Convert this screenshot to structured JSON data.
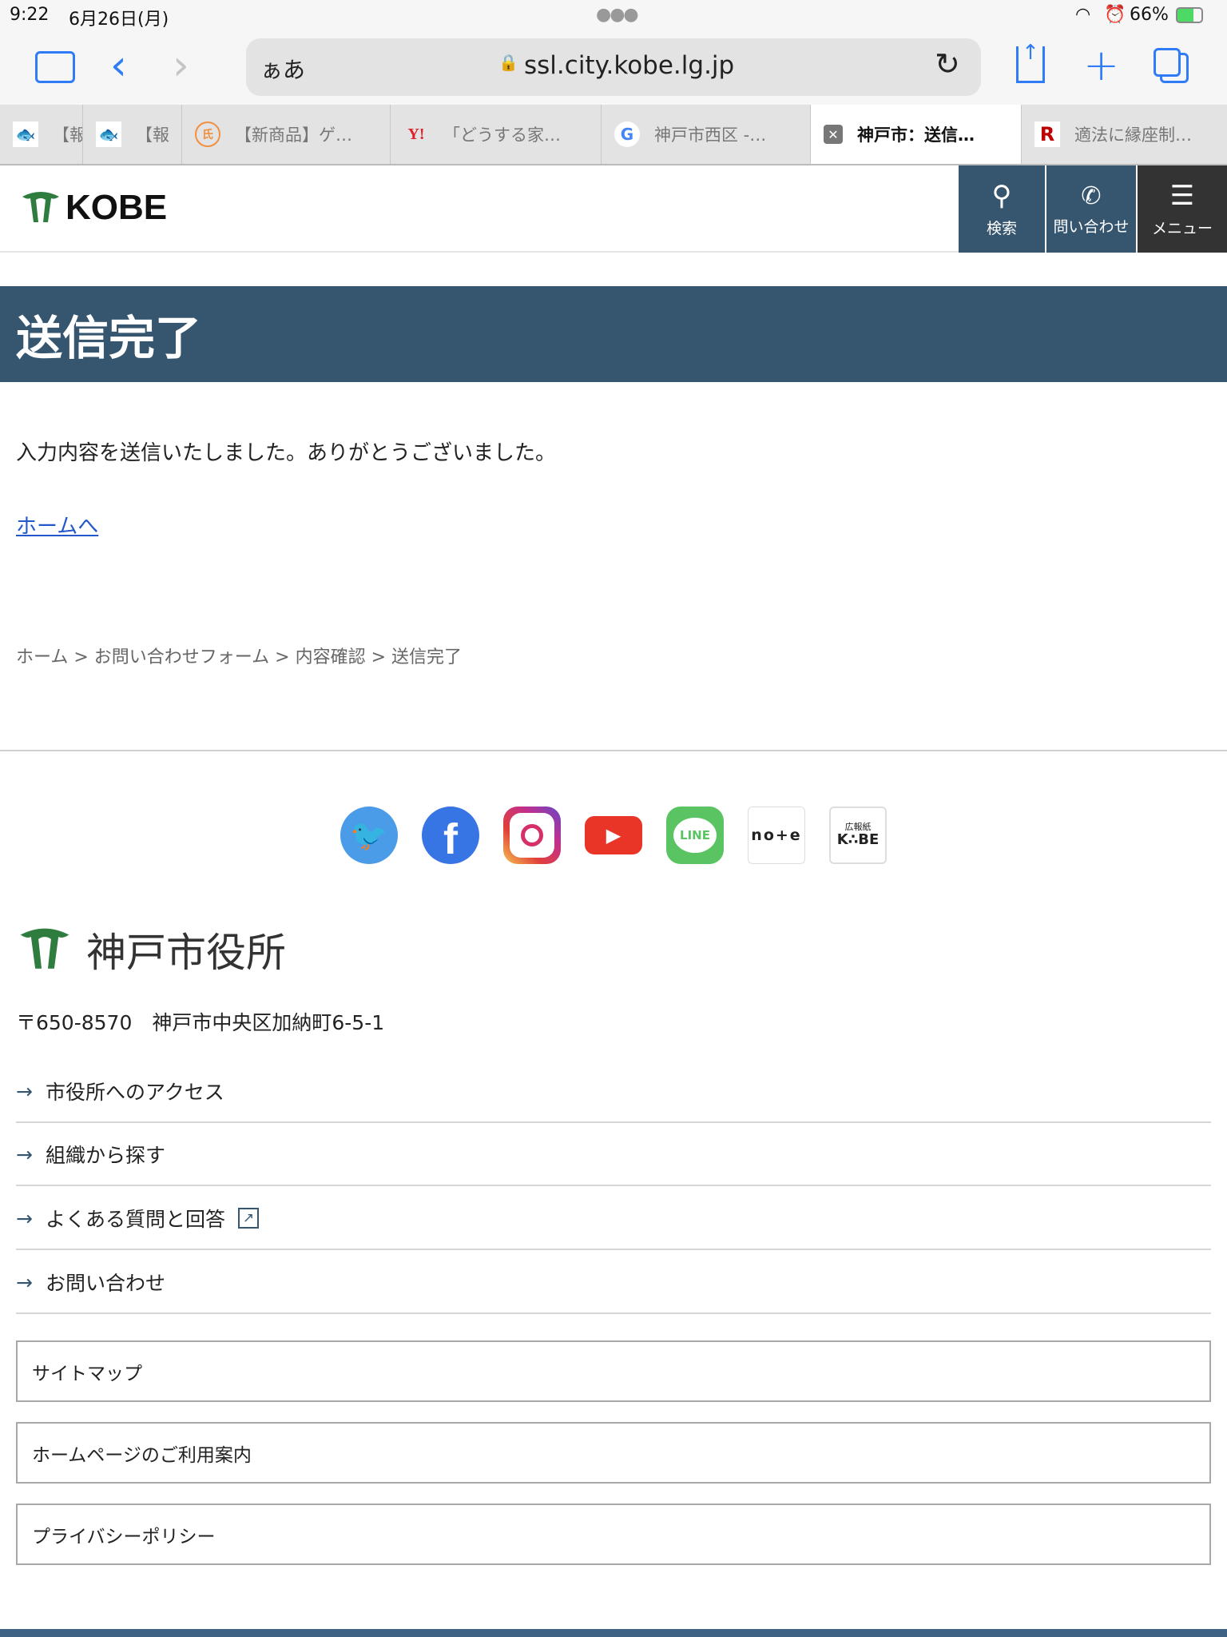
{
  "status": {
    "time": "9:22",
    "date": "6月26日(月)",
    "battery": "66%"
  },
  "browser": {
    "aa": "ぁあ",
    "url": "ssl.city.kobe.lg.jp"
  },
  "tabs": [
    {
      "label": "【報",
      "icon": "fish-icon"
    },
    {
      "label": "【報",
      "icon": "fish-icon"
    },
    {
      "label": "【新商品】ゲ…",
      "icon": "orange-logo-icon"
    },
    {
      "label": "「どうする家…",
      "icon": "yahoo-icon",
      "fav": "Y!"
    },
    {
      "label": "神戸市西区 -…",
      "icon": "google-icon",
      "fav": "G"
    },
    {
      "label": "神戸市：送信…",
      "icon": "close-icon",
      "fav": "✕"
    },
    {
      "label": "適法に縁座制…",
      "icon": "rakuten-icon",
      "fav": "R"
    }
  ],
  "header": {
    "logo": "KOBE",
    "search": "検索",
    "contact": "問い合わせ",
    "menu": "メニュー"
  },
  "page": {
    "title": "送信完了",
    "message": "入力内容を送信いたしました。ありがとうございました。",
    "home_link": "ホームへ"
  },
  "breadcrumb": [
    "ホーム",
    "お問い合わせフォーム",
    "内容確認",
    "送信完了"
  ],
  "breadcrumb_sep": ">",
  "social": [
    "twitter",
    "facebook",
    "instagram",
    "youtube",
    "line",
    "note",
    "koho-kobe"
  ],
  "social_text": {
    "line": "LINE",
    "note": "no+e",
    "koho_top": "広報紙",
    "koho_bottom": "K∴BE"
  },
  "footer": {
    "org": "神戸市役所",
    "address": "〒650-8570　神戸市中央区加納町6-5-1",
    "links": [
      "市役所へのアクセス",
      "組織から探す",
      "よくある質問と回答",
      "お問い合わせ"
    ],
    "boxes": [
      "サイトマップ",
      "ホームページのご利用案内",
      "プライバシーポリシー"
    ]
  },
  "colors": {
    "brand": "#36566f",
    "link": "#2258c9",
    "accent": "#2f7cf6"
  }
}
